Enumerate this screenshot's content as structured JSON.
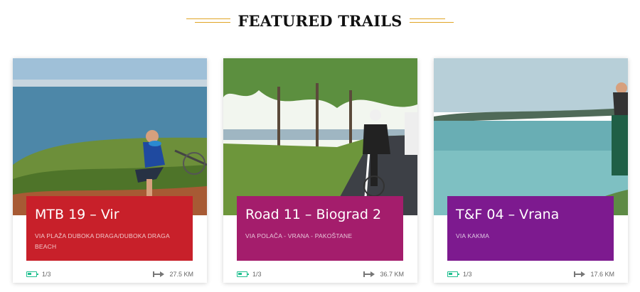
{
  "section": {
    "title": "FEATURED TRAILS"
  },
  "cards": [
    {
      "title": "MTB 19 – Vir",
      "subtitle": "VIA PLAŽA DUBOKA DRAGA/DUBOKA DRAGA BEACH",
      "color": "#c8202a",
      "difficulty": "1/3",
      "distance": "27.5 KM"
    },
    {
      "title": "Road 11 – Biograd 2",
      "subtitle": "VIA POLAČA - VRANA - PAKOŠTANE",
      "color": "#a41d6c",
      "difficulty": "1/3",
      "distance": "36.7 KM"
    },
    {
      "title": "T&F 04 – Vrana",
      "subtitle": "VIA KAKMA",
      "color": "#7d1a8f",
      "difficulty": "1/3",
      "distance": "17.6 KM"
    }
  ],
  "icons": {
    "difficulty": "battery-icon",
    "distance": "distance-arrow-icon"
  }
}
